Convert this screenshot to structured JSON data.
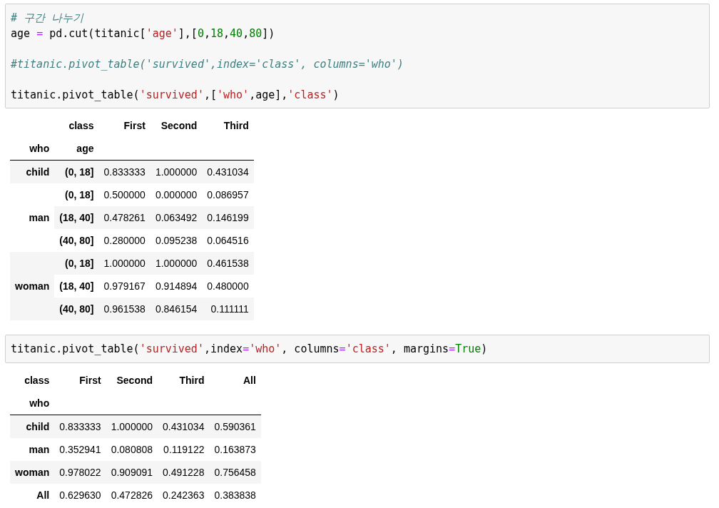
{
  "cells": [
    {
      "code": [
        {
          "kind": "code",
          "tokens": [
            {
              "kind": "comment",
              "text": "# 구간 나누기"
            }
          ]
        },
        {
          "kind": "code",
          "tokens": [
            {
              "kind": "plain",
              "text": "age "
            },
            {
              "kind": "operator",
              "text": "="
            },
            {
              "kind": "plain",
              "text": " pd.cut(titanic["
            },
            {
              "kind": "string",
              "text": "'age'"
            },
            {
              "kind": "plain",
              "text": "],["
            },
            {
              "kind": "number",
              "text": "0"
            },
            {
              "kind": "plain",
              "text": ","
            },
            {
              "kind": "number",
              "text": "18"
            },
            {
              "kind": "plain",
              "text": ","
            },
            {
              "kind": "number",
              "text": "40"
            },
            {
              "kind": "plain",
              "text": ","
            },
            {
              "kind": "number",
              "text": "80"
            },
            {
              "kind": "plain",
              "text": "])"
            }
          ]
        },
        {
          "kind": "blank"
        },
        {
          "kind": "code",
          "tokens": [
            {
              "kind": "comment",
              "text": "#titanic.pivot_table('survived',index='class', columns='who')"
            }
          ]
        },
        {
          "kind": "blank"
        },
        {
          "kind": "code",
          "tokens": [
            {
              "kind": "plain",
              "text": "titanic.pivot_table("
            },
            {
              "kind": "string",
              "text": "'survived'"
            },
            {
              "kind": "plain",
              "text": ",["
            },
            {
              "kind": "string",
              "text": "'who'"
            },
            {
              "kind": "plain",
              "text": ",age],"
            },
            {
              "kind": "string",
              "text": "'class'"
            },
            {
              "kind": "plain",
              "text": ")"
            }
          ]
        }
      ],
      "output": {
        "kind": "multi",
        "columns_name": "class",
        "columns": [
          "First",
          "Second",
          "Third"
        ],
        "index_names": [
          "who",
          "age"
        ],
        "groups": [
          {
            "label": "child",
            "rows": [
              {
                "label": "(0, 18]",
                "values": [
                  "0.833333",
                  "1.000000",
                  "0.431034"
                ]
              }
            ]
          },
          {
            "label": "man",
            "rows": [
              {
                "label": "(0, 18]",
                "values": [
                  "0.500000",
                  "0.000000",
                  "0.086957"
                ]
              },
              {
                "label": "(18, 40]",
                "values": [
                  "0.478261",
                  "0.063492",
                  "0.146199"
                ]
              },
              {
                "label": "(40, 80]",
                "values": [
                  "0.280000",
                  "0.095238",
                  "0.064516"
                ]
              }
            ]
          },
          {
            "label": "woman",
            "rows": [
              {
                "label": "(0, 18]",
                "values": [
                  "1.000000",
                  "1.000000",
                  "0.461538"
                ]
              },
              {
                "label": "(18, 40]",
                "values": [
                  "0.979167",
                  "0.914894",
                  "0.480000"
                ]
              },
              {
                "label": "(40, 80]",
                "values": [
                  "0.961538",
                  "0.846154",
                  "0.111111"
                ]
              }
            ]
          }
        ]
      }
    },
    {
      "code": [
        {
          "kind": "code",
          "tokens": [
            {
              "kind": "plain",
              "text": "titanic.pivot_table("
            },
            {
              "kind": "string",
              "text": "'survived'"
            },
            {
              "kind": "plain",
              "text": ",index"
            },
            {
              "kind": "operator",
              "text": "="
            },
            {
              "kind": "string",
              "text": "'who'"
            },
            {
              "kind": "plain",
              "text": ", columns"
            },
            {
              "kind": "operator",
              "text": "="
            },
            {
              "kind": "string",
              "text": "'class'"
            },
            {
              "kind": "plain",
              "text": ", margins"
            },
            {
              "kind": "operator",
              "text": "="
            },
            {
              "kind": "keyword",
              "text": "True"
            },
            {
              "kind": "plain",
              "text": ")"
            }
          ]
        }
      ],
      "output": {
        "kind": "simple",
        "columns_name": "class",
        "columns": [
          "First",
          "Second",
          "Third",
          "All"
        ],
        "index_names": [
          "who"
        ],
        "groups": [
          {
            "label": "child",
            "rows": [
              {
                "values": [
                  "0.833333",
                  "1.000000",
                  "0.431034",
                  "0.590361"
                ]
              }
            ]
          },
          {
            "label": "man",
            "rows": [
              {
                "values": [
                  "0.352941",
                  "0.080808",
                  "0.119122",
                  "0.163873"
                ]
              }
            ]
          },
          {
            "label": "woman",
            "rows": [
              {
                "values": [
                  "0.978022",
                  "0.909091",
                  "0.491228",
                  "0.756458"
                ]
              }
            ]
          },
          {
            "label": "All",
            "rows": [
              {
                "values": [
                  "0.629630",
                  "0.472826",
                  "0.242363",
                  "0.383838"
                ]
              }
            ]
          }
        ]
      }
    }
  ]
}
